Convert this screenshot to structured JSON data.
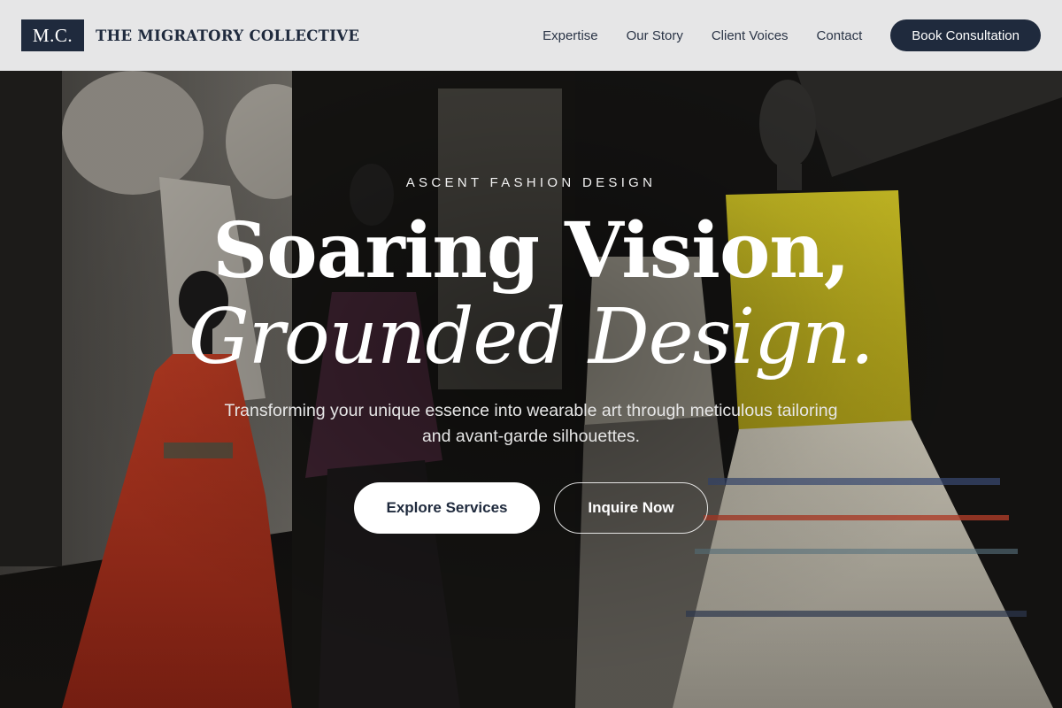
{
  "header": {
    "logo_mark": "M.C.",
    "brand_name": "THE MIGRATORY COLLECTIVE",
    "nav": [
      {
        "label": "Expertise"
      },
      {
        "label": "Our Story"
      },
      {
        "label": "Client Voices"
      },
      {
        "label": "Contact"
      }
    ],
    "cta_label": "Book Consultation"
  },
  "hero": {
    "eyebrow": "ASCENT FASHION DESIGN",
    "title_line1": "Soaring Vision,",
    "title_line2": "Grounded Design.",
    "subtitle": "Transforming your unique essence into wearable art through meticulous tailoring and avant-garde silhouettes.",
    "primary_button": "Explore Services",
    "secondary_button": "Inquire Now"
  },
  "colors": {
    "brand_navy": "#1f2a3d",
    "header_bg": "#f1f1f2",
    "text_light": "#ffffff"
  }
}
